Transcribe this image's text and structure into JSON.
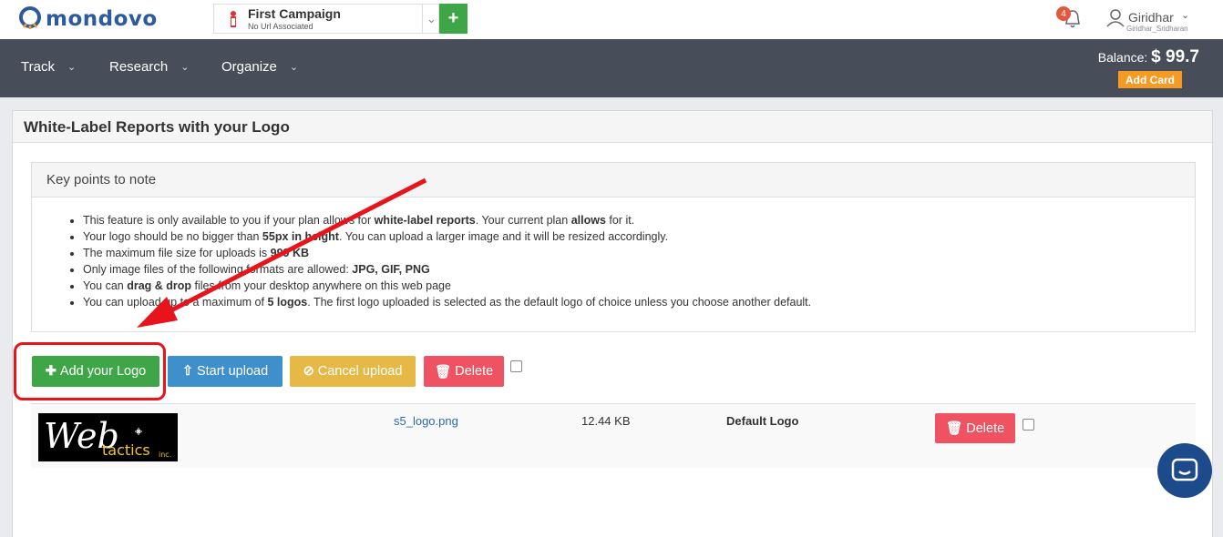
{
  "header": {
    "brand": "mondovo",
    "campaign": {
      "name": "First Campaign",
      "url": "No Url Associated"
    },
    "add_campaign_label": "+",
    "notifications": {
      "count": "4"
    },
    "user": {
      "name": "Giridhar",
      "handle": "Giridhar_Sridharan"
    }
  },
  "nav": {
    "items": [
      {
        "label": "Track"
      },
      {
        "label": "Research"
      },
      {
        "label": "Organize"
      }
    ],
    "balance_label": "Balance:",
    "balance_amount": "$ 99.7",
    "add_card_label": "Add Card"
  },
  "panel": {
    "title": "White-Label Reports with your Logo",
    "notes_title": "Key points to note",
    "notes": [
      {
        "pre": "This feature is only available to you if your plan allows for ",
        "b1": "white-label reports",
        "mid": ". Your current plan ",
        "b2": "allows",
        "post": " for it."
      },
      {
        "pre": "Your logo should be no bigger than ",
        "b1": "55px in height",
        "mid": ". You can upload a larger image and it will be resized accordingly.",
        "b2": "",
        "post": ""
      },
      {
        "pre": "The maximum file size for uploads is ",
        "b1": "999 KB",
        "mid": "",
        "b2": "",
        "post": ""
      },
      {
        "pre": "Only image files of the following formats are allowed: ",
        "b1": "JPG, GIF, PNG",
        "mid": "",
        "b2": "",
        "post": ""
      },
      {
        "pre": "You can ",
        "b1": "drag & drop",
        "mid": " files from your desktop anywhere on this web page",
        "b2": "",
        "post": ""
      },
      {
        "pre": "You can upload up to a maximum of ",
        "b1": "5 logos",
        "mid": ". The first logo uploaded is selected as the default logo of choice unless you choose another default.",
        "b2": "",
        "post": ""
      }
    ],
    "buttons": {
      "add_logo": "Add your Logo",
      "start_upload": "Start upload",
      "cancel_upload": "Cancel upload",
      "delete": "Delete"
    },
    "file": {
      "logo_text_main": "Web",
      "logo_text_sub": "tactics",
      "logo_text_inc": "inc.",
      "name": "s5_logo.png",
      "size": "12.44 KB",
      "status": "Default Logo",
      "delete_label": "Delete"
    }
  },
  "colors": {
    "navbar": "#474e59",
    "green": "#3fa648",
    "blue": "#3f8fcd",
    "yellow": "#e6b846",
    "red": "#ef5261",
    "orange": "#f59a23",
    "annotation_red": "#e8141c"
  }
}
